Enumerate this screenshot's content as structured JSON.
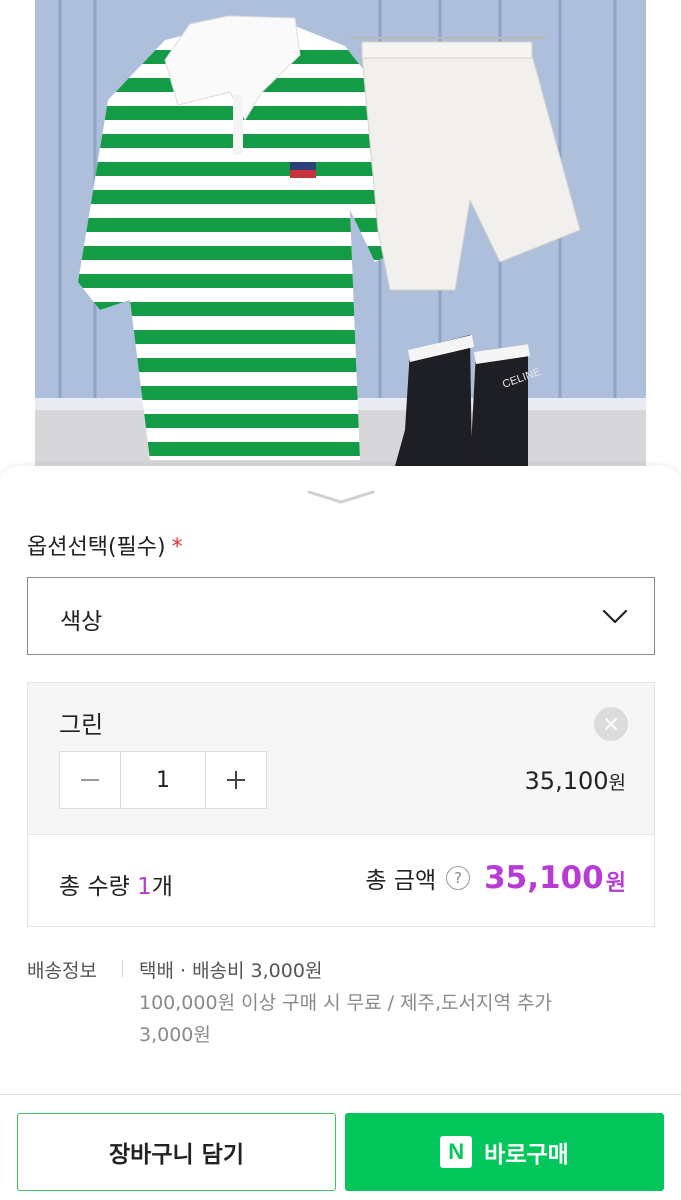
{
  "product_image": {
    "icon": "product-photo",
    "brand_tag": "CELINE"
  },
  "option": {
    "label": "옵션선택(필수)",
    "required_mark": "*",
    "select_value": "색상"
  },
  "selected_item": {
    "name": "그린",
    "quantity": "1",
    "minus": "−",
    "plus": "+",
    "price": "35,100",
    "price_unit": "원"
  },
  "total": {
    "qty_label": "총 수량",
    "qty_value": "1",
    "qty_unit": "개",
    "amount_label": "총 금액",
    "help": "?",
    "amount": "35,100",
    "amount_unit": "원"
  },
  "shipping": {
    "label": "배송정보",
    "line1": "택배 · 배송비 3,000원",
    "line2": "100,000원 이상 구매 시 무료 / 제주,도서지역 추가",
    "line3": "3,000원"
  },
  "footer": {
    "cart_label": "장바구니 담기",
    "buy_label": "바로구매",
    "npay_badge": "N"
  },
  "colors": {
    "accent_purple": "#b83bd6",
    "naver_green": "#03c75a",
    "required_red": "#e0323c"
  }
}
